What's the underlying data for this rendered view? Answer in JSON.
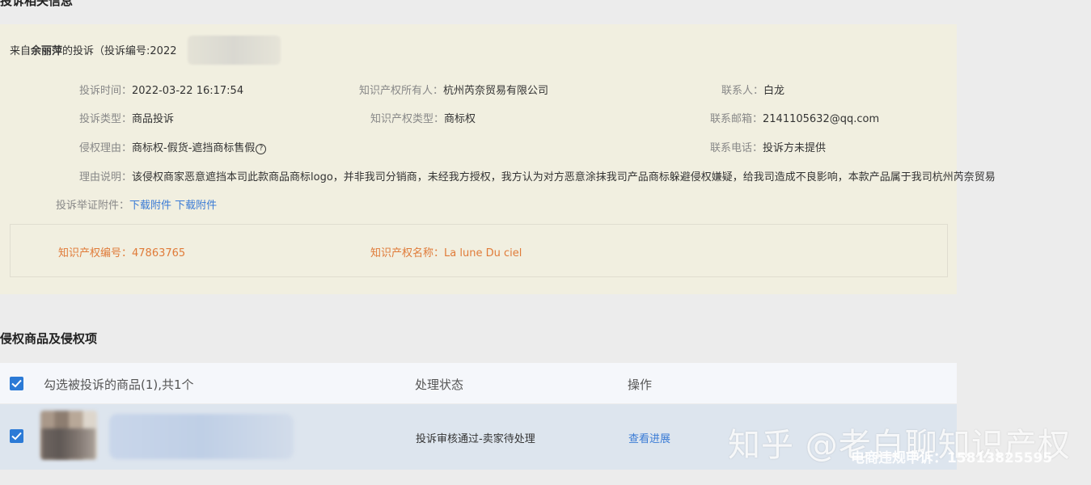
{
  "complaint_section": {
    "title": "投诉相关信息",
    "from_prefix": "来自",
    "complainant": "余丽萍",
    "from_suffix": "的投诉（投诉编号:2022",
    "fields": {
      "time_label": "投诉时间：",
      "time_value": "2022-03-22 16:17:54",
      "owner_label": "知识产权所有人：",
      "owner_value": "杭州芮奈贸易有限公司",
      "contact_label": "联系人：",
      "contact_value": "白龙",
      "type_label": "投诉类型：",
      "type_value": "商品投诉",
      "ip_type_label": "知识产权类型：",
      "ip_type_value": "商标权",
      "email_label": "联系邮箱：",
      "email_value": "2141105632@qq.com",
      "reason_label": "侵权理由：",
      "reason_value": "商标权-假货-遮挡商标售假",
      "help_glyph": "?",
      "phone_label": "联系电话：",
      "phone_value": "投诉方未提供",
      "explain_label": "理由说明：",
      "explain_value": "该侵权商家恶意遮挡本司此款商品商标logo，并非我司分销商，未经我方授权，我方认为对方恶意涂抹我司产品商标躲避侵权嫌疑，给我司造成不良影响，本款产品属于我司杭州芮奈贸易",
      "attach_label": "投诉举证附件：",
      "attach_link_1": "下载附件",
      "attach_link_2": "下载附件"
    },
    "ip": {
      "number_label": "知识产权编号：",
      "number_value": "47863765",
      "name_label": "知识产权名称：",
      "name_value": "La lune Du ciel"
    }
  },
  "products_section": {
    "title": "侵权商品及侵权项",
    "header": {
      "select_label": "勾选被投诉的商品(1),共1个",
      "status_label": "处理状态",
      "action_label": "操作"
    },
    "rows": [
      {
        "status": "投诉审核通过-卖家待处理",
        "action": "查看进展"
      }
    ]
  },
  "watermark": {
    "main": "知乎 @老白聊知识产权",
    "sub": "电商违规申诉：15813825595"
  },
  "colors": {
    "info_bg": "#f1efe0",
    "ip_text": "#e07b39",
    "link": "#3a7bd5",
    "checkbox": "#2b7ad6"
  }
}
